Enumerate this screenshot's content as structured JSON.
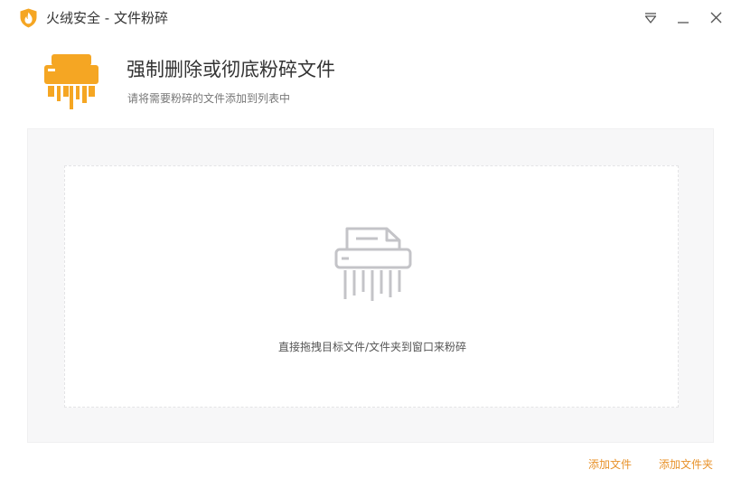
{
  "window": {
    "title": "火绒安全 - 文件粉碎"
  },
  "header": {
    "title": "强制删除或彻底粉碎文件",
    "subtitle": "请将需要粉碎的文件添加到列表中"
  },
  "drop_zone": {
    "hint": "直接拖拽目标文件/文件夹到窗口来粉碎"
  },
  "actions": {
    "add_file": "添加文件",
    "add_folder": "添加文件夹"
  },
  "icons": {
    "app": "flame-shield-icon",
    "hero": "shredder-icon",
    "drop": "shredder-outline-icon",
    "menu": "triangle-menu-icon",
    "minimize": "minimize-icon",
    "close": "close-icon"
  },
  "colors": {
    "accent": "#f5a623",
    "link": "#e8922a",
    "panel_bg": "#f7f7f8",
    "icon_gray": "#c4c4c8"
  }
}
